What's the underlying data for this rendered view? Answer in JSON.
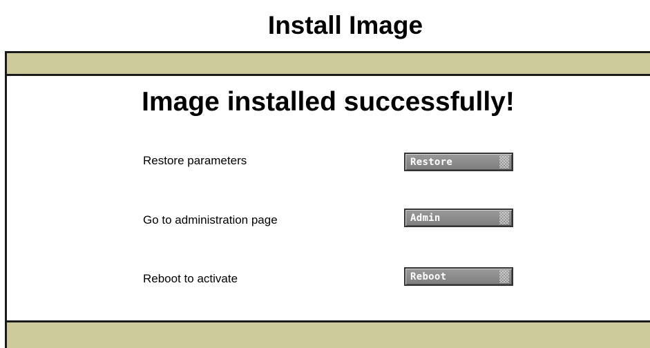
{
  "page": {
    "title": "Install Image"
  },
  "panel": {
    "heading": "Image installed successfully!"
  },
  "actions": [
    {
      "label": "Restore parameters",
      "button": "Restore"
    },
    {
      "label": "Go to administration page",
      "button": "Admin"
    },
    {
      "label": "Reboot to activate",
      "button": "Reboot"
    }
  ],
  "colors": {
    "bar": "#cdcb9c",
    "button": "#8a8a8a",
    "border": "#1a1a1a"
  }
}
